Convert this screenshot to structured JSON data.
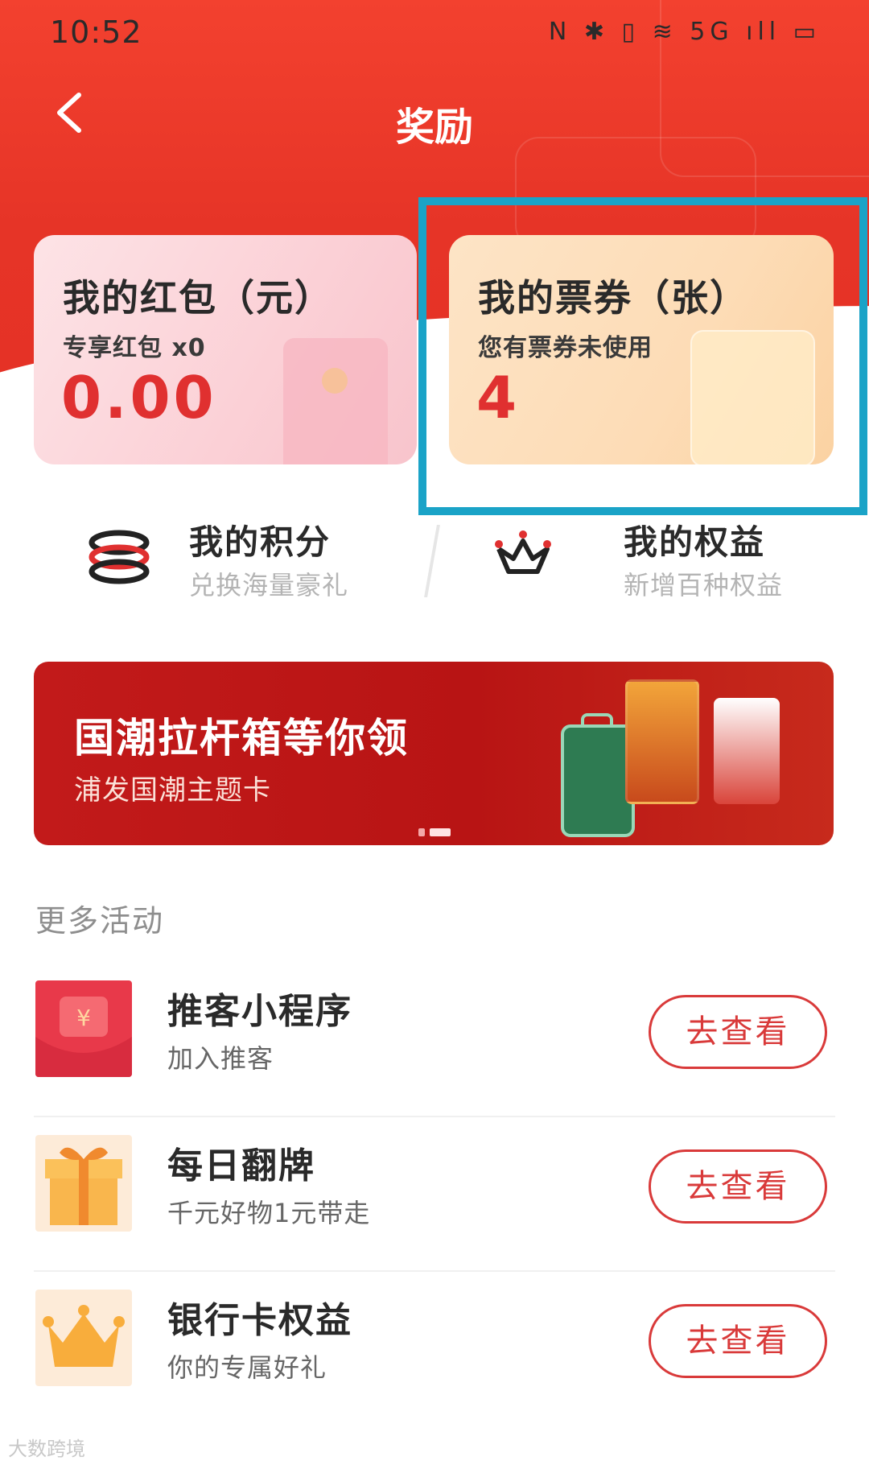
{
  "status_bar": {
    "time": "10:52",
    "icons": "N ✱ ▯ ≋ 5G ıll ▭"
  },
  "header": {
    "back_icon": "chevron-left-icon",
    "title": "奖励"
  },
  "cards": {
    "red_packet": {
      "title": "我的红包（元）",
      "subtitle": "专享红包 x0",
      "value": "0.00"
    },
    "tickets": {
      "title": "我的票券（张）",
      "subtitle": "您有票券未使用",
      "value": "4"
    }
  },
  "quick_links": [
    {
      "title": "我的积分",
      "subtitle": "兑换海量豪礼",
      "icon": "coin-stack-icon"
    },
    {
      "title": "我的权益",
      "subtitle": "新增百种权益",
      "icon": "crown-icon"
    }
  ],
  "banner": {
    "title": "国潮拉杆箱等你领",
    "subtitle": "浦发国潮主题卡"
  },
  "more_activities": {
    "section_title": "更多活动",
    "items": [
      {
        "title": "推客小程序",
        "subtitle": "加入推客",
        "button": "去查看",
        "icon": "red-envelope-icon"
      },
      {
        "title": "每日翻牌",
        "subtitle": "千元好物1元带走",
        "button": "去查看",
        "icon": "gift-box-icon"
      },
      {
        "title": "银行卡权益",
        "subtitle": "你的专属好礼",
        "button": "去查看",
        "icon": "crown-icon"
      }
    ]
  },
  "watermark": "大数跨境",
  "colors": {
    "primary_red": "#e53226",
    "highlight_border": "#1aa3c7",
    "value_red": "#e03030"
  }
}
